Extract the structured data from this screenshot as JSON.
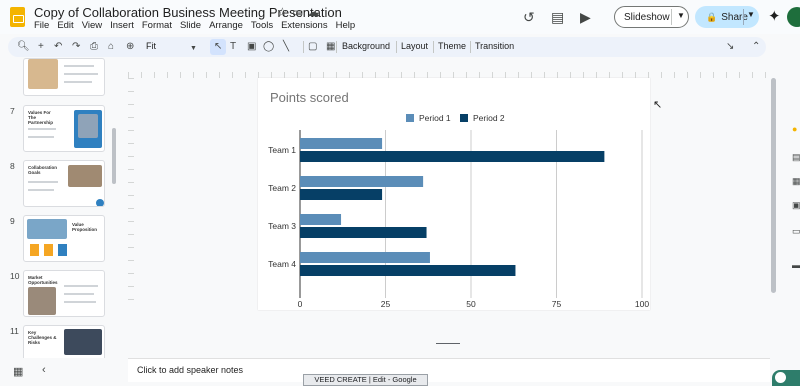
{
  "app": {
    "title": "Copy of Collaboration Business Meeting Presentation",
    "menu": [
      "File",
      "Edit",
      "View",
      "Insert",
      "Format",
      "Slide",
      "Arrange",
      "Tools",
      "Extensions",
      "Help"
    ]
  },
  "header": {
    "slideshow_label": "Slideshow",
    "share_label": "Share"
  },
  "toolbar": {
    "zoom_label": "Fit",
    "background_label": "Background",
    "layout_label": "Layout",
    "theme_label": "Theme",
    "transition_label": "Transition"
  },
  "filmstrip": {
    "slides": [
      {
        "number": "7",
        "title": "Values For The Partnership"
      },
      {
        "number": "8",
        "title": "Collaboration Goals"
      },
      {
        "number": "9",
        "title": "Value Proposition"
      },
      {
        "number": "10",
        "title": "Market Opportunities"
      },
      {
        "number": "11",
        "title": "Key Challenges & Risks"
      }
    ]
  },
  "notes": {
    "placeholder": "Click to add speaker notes"
  },
  "taskbar": {
    "window_label": "VEED CREATE | Edit - Google Chrome"
  },
  "colors": {
    "period1": "#5b8db8",
    "period2": "#063f66",
    "share_bg": "#c2e7ff",
    "gridline": "#cccccc"
  },
  "chart_data": {
    "type": "bar",
    "orientation": "horizontal",
    "title": "Points scored",
    "categories": [
      "Team 1",
      "Team 2",
      "Team 3",
      "Team 4"
    ],
    "series": [
      {
        "name": "Period 1",
        "values": [
          24,
          36,
          12,
          38
        ]
      },
      {
        "name": "Period 2",
        "values": [
          89,
          24,
          37,
          63
        ]
      }
    ],
    "xlim": [
      0,
      100
    ],
    "xticks": [
      "0",
      "25",
      "50",
      "75",
      "100"
    ],
    "legend": "top",
    "grid": true
  }
}
